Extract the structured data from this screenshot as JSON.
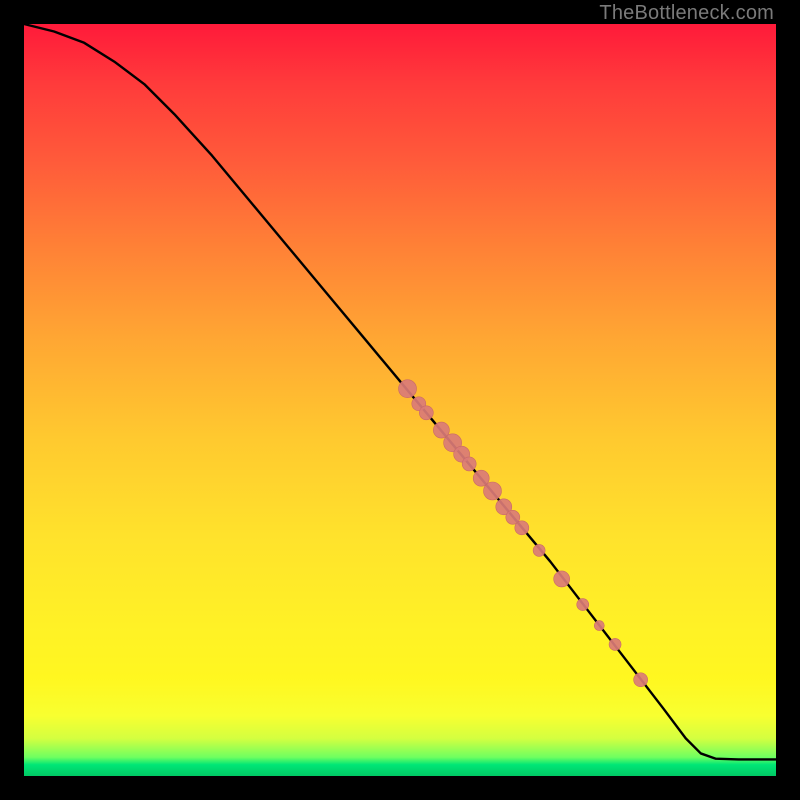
{
  "watermark": "TheBottleneck.com",
  "colors": {
    "curve": "#000000",
    "dot_fill": "#da7b77",
    "dot_stroke": "#c96a67"
  },
  "chart_data": {
    "type": "line",
    "title": "",
    "xlabel": "",
    "ylabel": "",
    "xlim": [
      0,
      100
    ],
    "ylim": [
      0,
      100
    ],
    "series": [
      {
        "name": "curve",
        "x": [
          0,
          4,
          8,
          12,
          16,
          20,
          25,
          30,
          35,
          40,
          45,
          50,
          55,
          60,
          65,
          70,
          75,
          80,
          85,
          88,
          90,
          92,
          95,
          100
        ],
        "y": [
          100,
          99,
          97.5,
          95,
          92,
          88,
          82.5,
          76.5,
          70.5,
          64.5,
          58.5,
          52.5,
          46.5,
          40.5,
          34.5,
          28.5,
          22,
          15.5,
          9,
          5,
          3,
          2.3,
          2.2,
          2.2
        ]
      }
    ],
    "dots": [
      {
        "x": 51.0,
        "y": 51.5,
        "r": 9
      },
      {
        "x": 52.5,
        "y": 49.5,
        "r": 7
      },
      {
        "x": 53.5,
        "y": 48.3,
        "r": 7
      },
      {
        "x": 55.5,
        "y": 46.0,
        "r": 8
      },
      {
        "x": 57.0,
        "y": 44.3,
        "r": 9
      },
      {
        "x": 58.2,
        "y": 42.8,
        "r": 8
      },
      {
        "x": 59.2,
        "y": 41.5,
        "r": 7
      },
      {
        "x": 60.8,
        "y": 39.6,
        "r": 8
      },
      {
        "x": 62.3,
        "y": 37.9,
        "r": 9
      },
      {
        "x": 63.8,
        "y": 35.8,
        "r": 8
      },
      {
        "x": 65.0,
        "y": 34.4,
        "r": 7
      },
      {
        "x": 66.2,
        "y": 33.0,
        "r": 7
      },
      {
        "x": 68.5,
        "y": 30.0,
        "r": 6
      },
      {
        "x": 71.5,
        "y": 26.2,
        "r": 8
      },
      {
        "x": 74.3,
        "y": 22.8,
        "r": 6
      },
      {
        "x": 76.5,
        "y": 20.0,
        "r": 5
      },
      {
        "x": 78.6,
        "y": 17.5,
        "r": 6
      },
      {
        "x": 82.0,
        "y": 12.8,
        "r": 7
      }
    ]
  }
}
